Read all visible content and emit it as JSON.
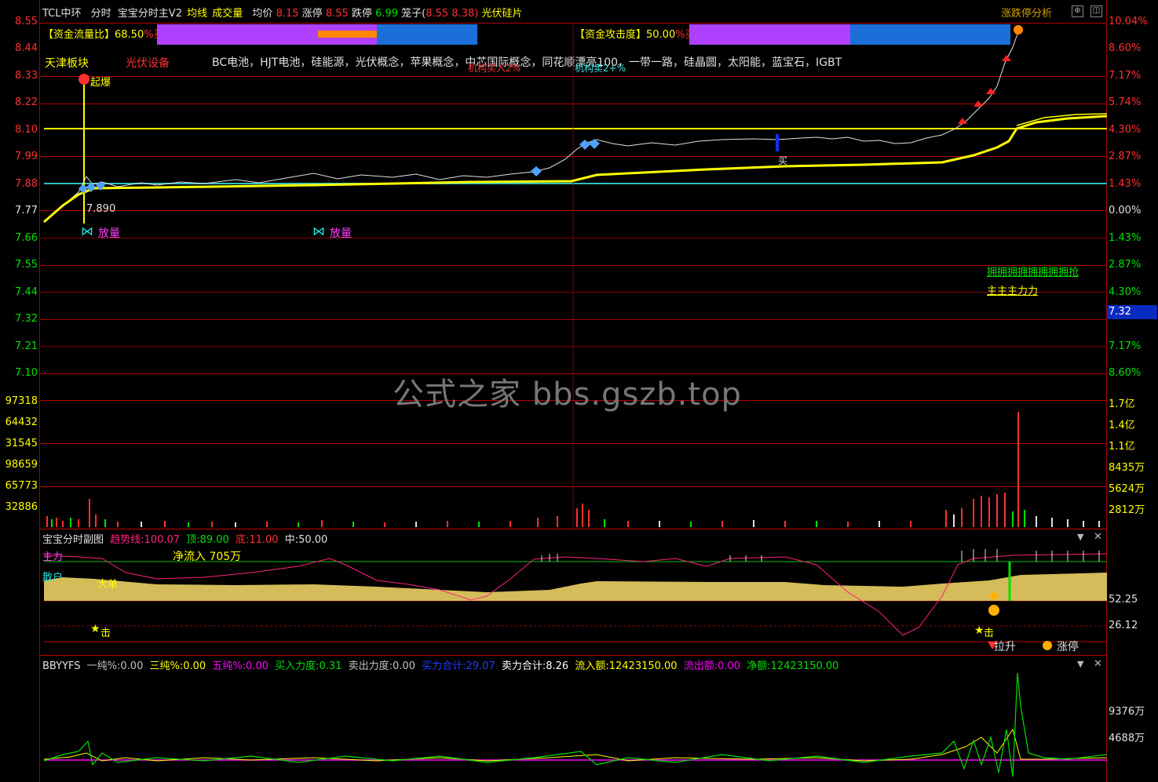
{
  "header": {
    "stock": "TCL中环",
    "mode": "分时",
    "indicator": "宝宝分时主V2",
    "avg_line": "均线",
    "volume": "成交量",
    "avg_price_label": "均价",
    "avg_price": "8.15",
    "limit_up_label": "涨停",
    "limit_up": "8.55",
    "limit_down_label": "跌停",
    "limit_down": "6.99",
    "cage_label": "笼子(",
    "cage_a": "8.55",
    "cage_b": "8.38)",
    "sector": "光伏硅片",
    "analysis_button": "涨跌停分析"
  },
  "flow": {
    "ratio_label": "【资金流量比】68.50",
    "ratio_suffix": "%买",
    "ratio_value": 68.5,
    "attack_label": "【资金攻击度】50.00",
    "attack_suffix": "%买",
    "attack_value": 50.0
  },
  "tags": {
    "board": "天津板块",
    "industry": "光伏设备",
    "concepts": "BC电池，HJT电池，硅能源，光伏概念，苹果概念，中芯国际概念，同花顺漂亮100，一带一路，硅晶圆，太阳能，蓝宝石，IGBT",
    "under1": "机构买入2%",
    "under2": "机构卖2+%"
  },
  "main_annotations": {
    "qibao": "起爆",
    "price_marker": "7.890",
    "fangliang": "放量",
    "buy": "买",
    "sell": "买",
    "flags": "拥拥拥拥拥拥拥拥抢",
    "main_force": "主主主力力"
  },
  "price_axis": [
    "8.55",
    "8.44",
    "8.33",
    "8.22",
    "8.10",
    "7.99",
    "7.88",
    "7.77",
    "7.66",
    "7.55",
    "7.44",
    "7.32",
    "7.21",
    "7.10"
  ],
  "pct_axis": [
    "10.04%",
    "8.60%",
    "7.17%",
    "5.74%",
    "4.30%",
    "2.87%",
    "1.43%",
    "0.00%",
    "1.43%",
    "2.87%",
    "4.30%",
    "5.74%",
    "7.17%",
    "8.60%"
  ],
  "current_price_tag": "7.32",
  "volume_axis_left": [
    "97318",
    "64432",
    "31545",
    "98659",
    "65773",
    "32886"
  ],
  "volume_axis_right": [
    "1.7亿",
    "1.4亿",
    "1.1亿",
    "8435万",
    "5624万",
    "2812万"
  ],
  "watermark": "公式之家 bbs.gszb.top",
  "sub1": {
    "title": "宝宝分时副图",
    "trend_label": "趋势线:",
    "trend": "100.07",
    "top_label": "顶:",
    "top": "89.00",
    "bottom_label": "底:",
    "bottom": "11.00",
    "mid_label": "中:",
    "mid": "50.00",
    "net_inflow": "净流入 705万",
    "cut1": "主力",
    "cut2": "散户",
    "big_order": "大单",
    "strike1": "击",
    "strike2": "击",
    "pull_up": "拉升",
    "limit_up": "涨停",
    "axis": [
      "52.25",
      "26.12"
    ]
  },
  "sub2": {
    "title": "BBYYFS",
    "items": [
      {
        "label": "一纯%:",
        "value": "0.00",
        "color": "#c0c0c0"
      },
      {
        "label": "三纯%:",
        "value": "0.00",
        "color": "#ffff00"
      },
      {
        "label": "五纯%:",
        "value": "0.00",
        "color": "#ff00ff"
      },
      {
        "label": "买入力度:",
        "value": "0.31",
        "color": "#00ff00"
      },
      {
        "label": "卖出力度:",
        "value": "0.00",
        "color": "#c0c0c0"
      },
      {
        "label": "买力合计:",
        "value": "29.07",
        "color": "#2040ff"
      },
      {
        "label": "卖力合计:",
        "value": "8.26",
        "color": "#ffffff"
      },
      {
        "label": "流入额:",
        "value": "12423150.00",
        "color": "#ffff00"
      },
      {
        "label": "流出额:",
        "value": "0.00",
        "color": "#ff00ff"
      },
      {
        "label": "净额:",
        "value": "12423150.00",
        "color": "#00ff00"
      }
    ],
    "axis": [
      "9376万",
      "4688万"
    ]
  },
  "colors": {
    "up": "#ff3030",
    "down": "#00e000",
    "avg": "#ffff00",
    "price": "#e0e0e0",
    "grid": "#b00000"
  }
}
